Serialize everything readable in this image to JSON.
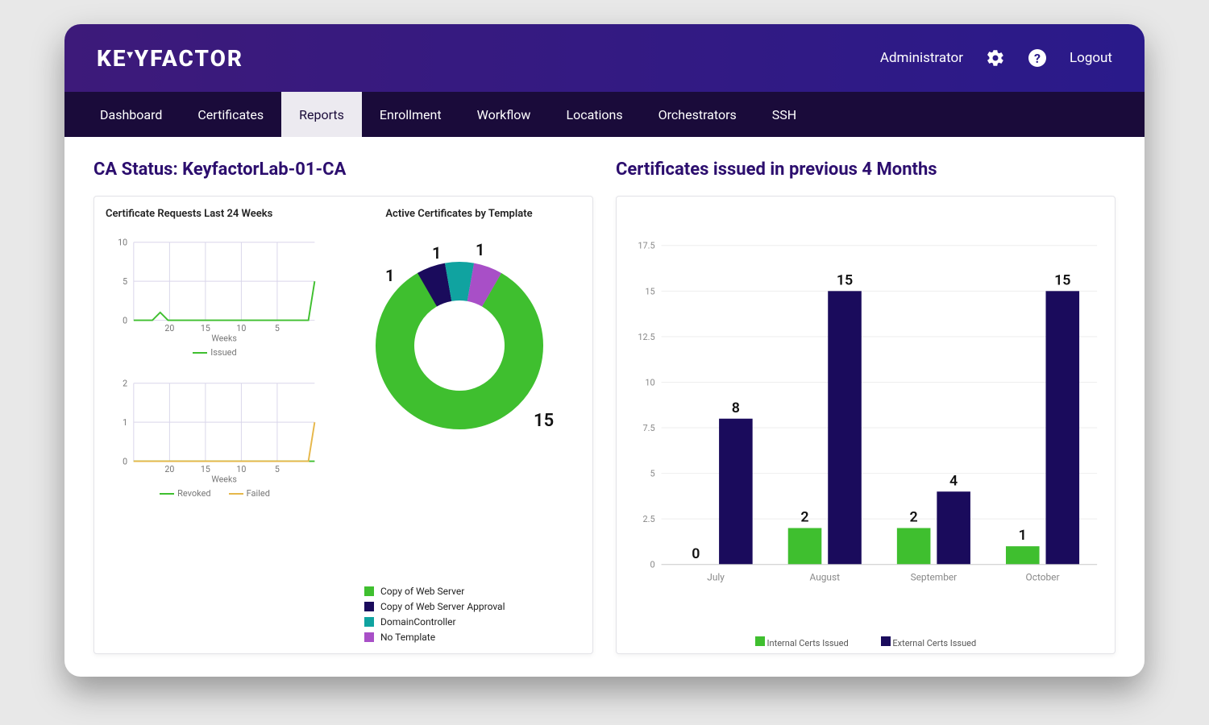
{
  "header": {
    "logo_text": "KEYFACTOR",
    "user_label": "Administrator",
    "logout_label": "Logout"
  },
  "nav": {
    "items": [
      "Dashboard",
      "Certificates",
      "Reports",
      "Enrollment",
      "Workflow",
      "Locations",
      "Orchestrators",
      "SSH"
    ],
    "active_index": 2
  },
  "left": {
    "title": "CA Status: KeyfactorLab-01-CA",
    "requests_title": "Certificate Requests Last 24 Weeks",
    "requests_xlabel": "Weeks",
    "issued_legend": "Issued",
    "revoked_legend": "Revoked",
    "failed_legend": "Failed",
    "donut_title": "Active Certificates by Template",
    "donut_labels": {
      "a": "15",
      "b": "1",
      "c": "1",
      "d": "1"
    },
    "donut_legend": [
      "Copy of Web Server",
      "Copy of Web Server Approval",
      "DomainController",
      "No Template"
    ]
  },
  "right": {
    "title": "Certificates issued in previous 4 Months",
    "legend_internal": "Internal Certs Issued",
    "legend_external": "External Certs Issued",
    "months": [
      "July",
      "August",
      "September",
      "October"
    ]
  },
  "chart_data": [
    {
      "type": "line",
      "title": "Certificate Requests Last 24 Weeks — Issued",
      "xlabel": "Weeks",
      "ylabel": "",
      "x_ticks": [
        20,
        15,
        10,
        5
      ],
      "ylim": [
        0,
        10
      ],
      "series": [
        {
          "name": "Issued",
          "color": "#3fbf2f",
          "x": [
            24,
            23,
            22,
            21,
            20,
            19,
            18,
            17,
            16,
            15,
            14,
            13,
            12,
            11,
            10,
            9,
            8,
            7,
            6,
            5,
            4,
            3,
            2,
            1,
            0
          ],
          "y": [
            0,
            0,
            0,
            1,
            0,
            0,
            0,
            0,
            0,
            0,
            0,
            0,
            0,
            0,
            0,
            0,
            0,
            0,
            0,
            0,
            0,
            0,
            0,
            0,
            5
          ]
        }
      ]
    },
    {
      "type": "line",
      "title": "Certificate Requests Last 24 Weeks — Revoked / Failed",
      "xlabel": "Weeks",
      "ylabel": "",
      "x_ticks": [
        20,
        15,
        10,
        5
      ],
      "ylim": [
        0,
        2
      ],
      "series": [
        {
          "name": "Revoked",
          "color": "#3fbf2f",
          "x": [
            24,
            0
          ],
          "y": [
            0,
            0
          ]
        },
        {
          "name": "Failed",
          "color": "#e6b74a",
          "x": [
            24,
            23,
            22,
            21,
            20,
            19,
            18,
            17,
            16,
            15,
            14,
            13,
            12,
            11,
            10,
            9,
            8,
            7,
            6,
            5,
            4,
            3,
            2,
            1,
            0
          ],
          "y": [
            0,
            0,
            0,
            0,
            0,
            0,
            0,
            0,
            0,
            0,
            0,
            0,
            0,
            0,
            0,
            0,
            0,
            0,
            0,
            0,
            0,
            0,
            0,
            0,
            1
          ]
        }
      ]
    },
    {
      "type": "pie",
      "title": "Active Certificates by Template",
      "series": [
        {
          "name": "Copy of Web Server",
          "value": 15,
          "color": "#3fbf2f"
        },
        {
          "name": "Copy of Web Server Approval",
          "value": 1,
          "color": "#1a0b5c"
        },
        {
          "name": "DomainController",
          "value": 1,
          "color": "#10a3a0"
        },
        {
          "name": "No Template",
          "value": 1,
          "color": "#a84fc7"
        }
      ]
    },
    {
      "type": "bar",
      "title": "Certificates issued in previous 4 Months",
      "xlabel": "",
      "ylabel": "",
      "ylim": [
        0,
        17.5
      ],
      "y_ticks": [
        0,
        2.5,
        5,
        7.5,
        10,
        12.5,
        15,
        17.5
      ],
      "categories": [
        "July",
        "August",
        "September",
        "October"
      ],
      "series": [
        {
          "name": "Internal Certs Issued",
          "color": "#3fbf2f",
          "values": [
            0,
            2,
            2,
            1
          ]
        },
        {
          "name": "External Certs Issued",
          "color": "#1a0b5c",
          "values": [
            8,
            15,
            4,
            15
          ]
        }
      ]
    }
  ]
}
